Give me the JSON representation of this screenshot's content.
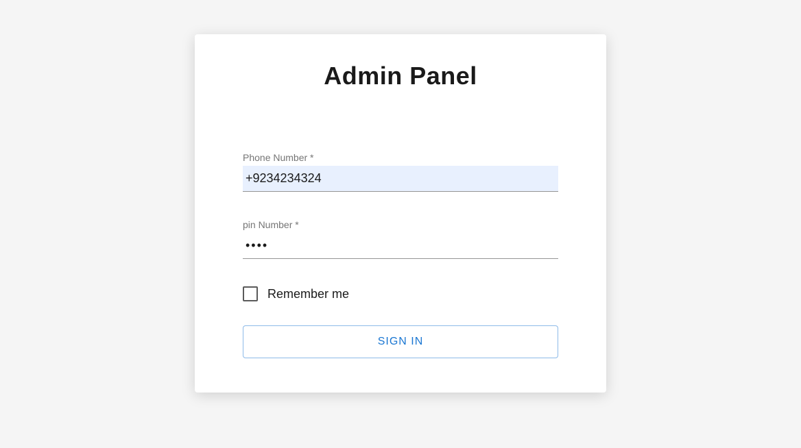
{
  "title": "Admin Panel",
  "fields": {
    "phone": {
      "label": "Phone Number *",
      "value": "+9234234324"
    },
    "pin": {
      "label": "pin Number *",
      "value": "••••"
    }
  },
  "remember": {
    "label": "Remember me",
    "checked": false
  },
  "submit": {
    "label": "SIGN IN"
  }
}
